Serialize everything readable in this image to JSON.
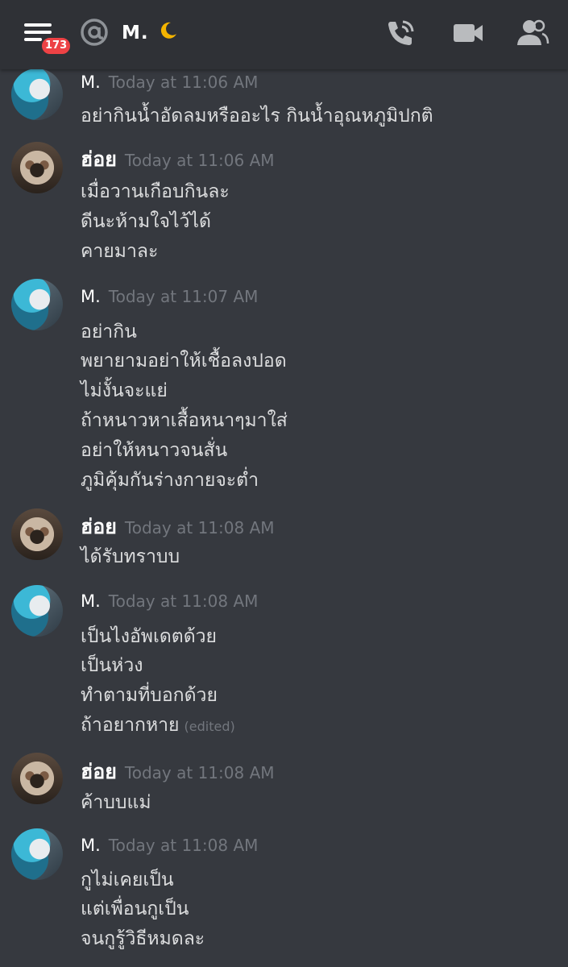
{
  "topbar": {
    "badge_count": "173",
    "channel_name": "M.",
    "icons": [
      "menu-icon",
      "at-icon",
      "moon-icon",
      "call-icon",
      "video-icon",
      "members-icon"
    ]
  },
  "messages": [
    {
      "author": "M.",
      "timestamp": "Today at 11:06 AM",
      "lines": [
        "อย่ากินน้ำอัดลมหรืออะไร กินน้ำอุณหภูมิปกติ"
      ]
    },
    {
      "author": "ฮ่อย",
      "timestamp": "Today at 11:06 AM",
      "lines": [
        "เมื่อวานเกือบกินละ",
        "ดีนะห้ามใจไว้ได้",
        "คายมาละ"
      ]
    },
    {
      "author": "M.",
      "timestamp": "Today at 11:07 AM",
      "lines": [
        "อย่ากิน",
        "พยายามอย่าให้เชื้อลงปอด",
        "ไม่งั้นจะแย่",
        "ถ้าหนาวหาเสื้อหนาๆมาใส่",
        "อย่าให้หนาวจนสั่น",
        "ภูมิคุ้มกันร่างกายจะต่ำ"
      ]
    },
    {
      "author": "ฮ่อย",
      "timestamp": "Today at 11:08 AM",
      "lines": [
        "ได้รับทราบบ"
      ]
    },
    {
      "author": "M.",
      "timestamp": "Today at 11:08 AM",
      "lines": [
        "เป็นไงอัพเดตด้วย",
        "เป็นห่วง",
        "ทำตามที่บอกด้วย",
        "ถ้าอยากหาย"
      ],
      "edited_label": "(edited)"
    },
    {
      "author": "ฮ่อย",
      "timestamp": "Today at 11:08 AM",
      "lines": [
        "ค้าบบแม่"
      ]
    },
    {
      "author": "M.",
      "timestamp": "Today at 11:08 AM",
      "lines": [
        "กูไม่เคยเป็น",
        "แต่เพื่อนกูเป็น",
        "จนกูรู้วิธีหมดละ"
      ]
    }
  ],
  "colors": {
    "background": "#36393f",
    "topbar": "#2f3136",
    "badge": "#ed4245",
    "timestamp": "#72767d",
    "message_text": "#dcddde"
  }
}
